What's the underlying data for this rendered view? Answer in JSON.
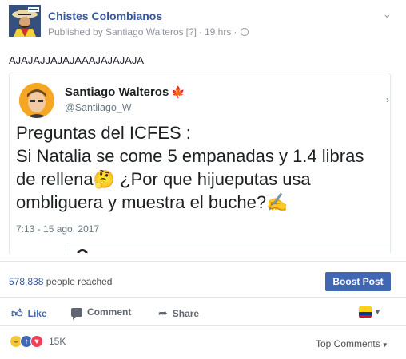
{
  "post": {
    "page_name": "Chistes Colombianos",
    "published_by": "Published by Santiago Walteros",
    "help_marker": "[?]",
    "separator": "·",
    "time_ago": "19 hrs",
    "text": "AJAJAJJAJAJAAAJAJAJAJA"
  },
  "tweet": {
    "author_name": "Santiago Walteros",
    "flag_emoji": "🍁",
    "handle": "@Santiiago_W",
    "lines": [
      "Preguntas del ICFES :",
      "Si Natalia se come 5 empanadas y 1.4 libras",
      "de rellena",
      "¿Por que hijueputas usa",
      "ombliguera y muestra el buche?"
    ],
    "thinking_emoji": "🤔",
    "writing_emoji": "✍️",
    "timestamp": "7:13 - 15 ago. 2017"
  },
  "stats": {
    "reach_count": "578,838",
    "reach_label": "people reached",
    "boost_label": "Boost Post"
  },
  "actions": {
    "like": "Like",
    "comment": "Comment",
    "share": "Share"
  },
  "reactions": {
    "count": "15K",
    "sort_label": "Top Comments"
  },
  "icons": {
    "globe": "globe-icon",
    "chevron": "chevron-down-icon",
    "like": "thumbs-up-icon",
    "comment": "speech-bubble-icon",
    "share": "share-arrow-icon"
  },
  "colors": {
    "facebook_blue": "#4267b2",
    "link_blue": "#365899",
    "meta_gray": "#90949c"
  }
}
